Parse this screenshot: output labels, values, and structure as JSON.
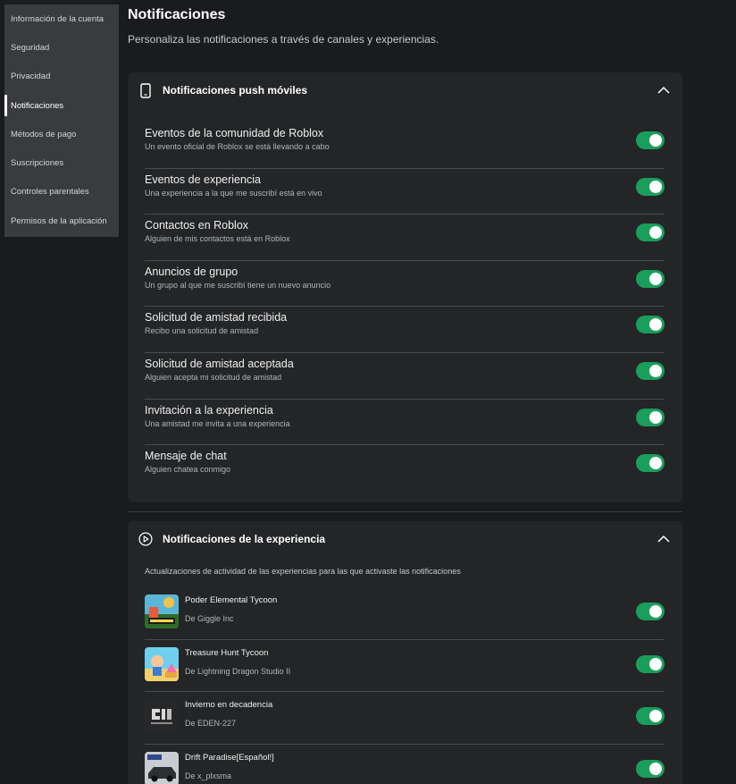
{
  "sidebar": {
    "items": [
      {
        "label": "Información de la cuenta",
        "active": false
      },
      {
        "label": "Seguridad",
        "active": false
      },
      {
        "label": "Privacidad",
        "active": false
      },
      {
        "label": "Notificaciones",
        "active": true
      },
      {
        "label": "Métodos de pago",
        "active": false
      },
      {
        "label": "Suscripciones",
        "active": false
      },
      {
        "label": "Controles parentales",
        "active": false
      },
      {
        "label": "Permisos de la aplicación",
        "active": false
      }
    ]
  },
  "header": {
    "title": "Notificaciones",
    "subtitle": "Personaliza las notificaciones a través de canales y experiencias."
  },
  "push_section": {
    "icon": "phone-icon",
    "title": "Notificaciones push móviles",
    "expanded": true,
    "rows": [
      {
        "title": "Eventos de la comunidad de Roblox",
        "desc": "Un evento oficial de Roblox se está llevando a cabo",
        "enabled": true
      },
      {
        "title": "Eventos de experiencia",
        "desc": "Una experiencia a la que me suscribí está en vivo",
        "enabled": true
      },
      {
        "title": "Contactos en Roblox",
        "desc": "Alguien de mis contactos está en Roblox",
        "enabled": true
      },
      {
        "title": "Anuncios de grupo",
        "desc": "Un grupo al que me suscribí tiene un nuevo anuncio",
        "enabled": true
      },
      {
        "title": "Solicitud de amistad recibida",
        "desc": "Recibo una solicitud de amistad",
        "enabled": true
      },
      {
        "title": "Solicitud de amistad aceptada",
        "desc": "Alguien acepta mi solicitud de amistad",
        "enabled": true
      },
      {
        "title": "Invitación a la experiencia",
        "desc": "Una amistad me invita a una experiencia",
        "enabled": true
      },
      {
        "title": "Mensaje de chat",
        "desc": "Alguien chatea conmigo",
        "enabled": true
      }
    ]
  },
  "experience_section": {
    "icon": "play-circle-icon",
    "title": "Notificaciones de la experiencia",
    "expanded": true,
    "intro": "Actualizaciones de actividad de las experiencias para las que activaste las notificaciones",
    "items": [
      {
        "name": "Poder Elemental Tycoon",
        "by": "De Giggle Inc",
        "enabled": true
      },
      {
        "name": "Treasure Hunt Tycoon",
        "by": "De Lightning Dragon Studio II",
        "enabled": true
      },
      {
        "name": "Invierno en decadencia",
        "by": "De EDEN-227",
        "enabled": true
      },
      {
        "name": "Drift Paradise[Español!]",
        "by": "De x_plxsma",
        "enabled": true
      }
    ]
  },
  "colors": {
    "toggle_on": "#1a9e5b",
    "background": "#1a1b1e",
    "card": "#232527",
    "sidebar": "#393b3d"
  }
}
